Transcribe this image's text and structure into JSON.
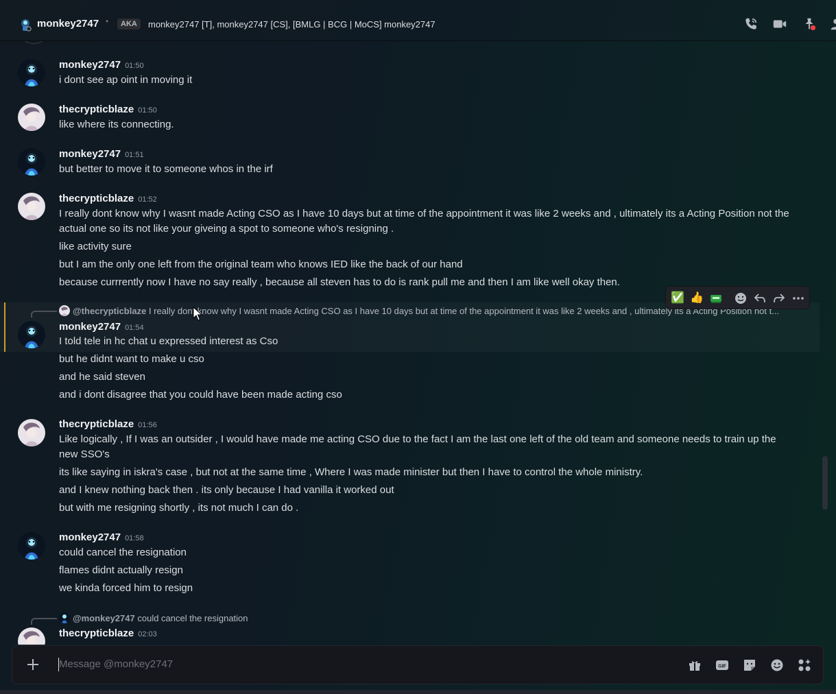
{
  "header": {
    "username": "monkey2747",
    "aka_badge": "AKA",
    "aliases": "monkey2747 [T], monkey2747 [CS], [BMLG | BCG | MoCS] monkey2747",
    "icons": [
      "voice-call-icon",
      "video-call-icon",
      "pinned-messages-icon",
      "profile-icon"
    ]
  },
  "messages": [
    {
      "author": "monkey2747",
      "time": "01:50",
      "avatar": "monkey",
      "lines": [
        "i dont see ap oint in moving it"
      ]
    },
    {
      "author": "thecrypticblaze",
      "time": "01:50",
      "avatar": "blaze",
      "lines": [
        "like where its connecting."
      ]
    },
    {
      "author": "monkey2747",
      "time": "01:51",
      "avatar": "monkey",
      "lines": [
        "but better to move it to someone whos in the irf"
      ]
    },
    {
      "author": "thecrypticblaze",
      "time": "01:52",
      "avatar": "blaze",
      "lines": [
        "I really dont know why I wasnt made Acting CSO as I have 10 days but at time of the appointment it was like 2 weeks and , ultimately its a Acting Position not the actual one so its not like your giveing a spot to someone who's resigning .",
        "like activity sure",
        "but I am the only one left from the original team who knows IED like the back of our hand",
        "because currrently now I have no say really , because all steven has to do is rank pull me and then I am like well okay then."
      ]
    },
    {
      "author": "monkey2747",
      "time": "01:54",
      "avatar": "monkey",
      "reply": {
        "mention": "@thecrypticblaze",
        "text": "I really dont know why I wasnt made Acting CSO as I have 10 days but at time of the appointment it was like 2 weeks and , ultimately its a Acting Position not t..."
      },
      "lines": [
        "I told tele in hc chat u expressed interest as Cso",
        "but he didnt want to make u cso",
        "and he said steven",
        "and i dont disagree that you could have been made acting cso"
      ]
    },
    {
      "author": "thecrypticblaze",
      "time": "01:56",
      "avatar": "blaze",
      "lines": [
        "Like logically , If I was an outsider , I would have made me acting CSO due to the fact I am the last one left of the old team and someone needs to train up the new SSO's",
        "its like saying in iskra's case , but not at the same time , Where I was made minister but then I have to control the whole ministry.",
        "and I knew nothing back then . its only because I had vanilla it worked out",
        "but with me resigning shortly , its not much I can do ."
      ]
    },
    {
      "author": "monkey2747",
      "time": "01:58",
      "avatar": "monkey",
      "lines": [
        "could cancel the resignation",
        "flames didnt actually resign",
        "we kinda forced him to resign"
      ]
    },
    {
      "author": "thecrypticblaze",
      "time": "02:03",
      "avatar": "blaze",
      "reply": {
        "mention": "@monkey2747",
        "text": "could cancel the resignation"
      },
      "lines": []
    }
  ],
  "toolbar": {
    "items": [
      "white-check-mark-reaction",
      "thumbs-up-reaction",
      "custom-emoji-reaction",
      "add-reaction-icon",
      "reply-icon",
      "forward-icon",
      "more-options-icon"
    ],
    "reaction_check": "✅",
    "reaction_thumbs": "👍"
  },
  "composer": {
    "placeholder": "Message @monkey2747",
    "icons": [
      "gift-icon",
      "gif-icon",
      "sticker-icon",
      "emoji-icon",
      "apps-icon"
    ],
    "gif_label": "GIF"
  },
  "colors": {
    "accent_bar": "#c9a227",
    "background": "#0f1a24",
    "text": "#dbdee1"
  }
}
